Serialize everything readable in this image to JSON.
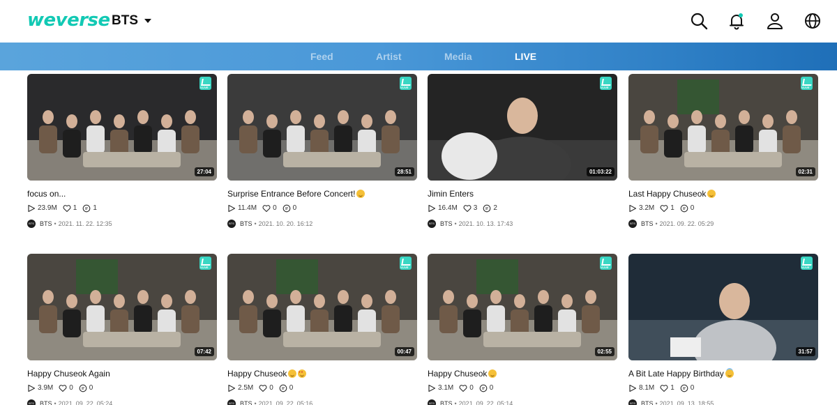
{
  "header": {
    "logo": "weverse",
    "artist": "BTS"
  },
  "nav": {
    "tabs": [
      {
        "label": "Feed",
        "active": false
      },
      {
        "label": "Artist",
        "active": false
      },
      {
        "label": "Media",
        "active": false
      },
      {
        "label": "LIVE",
        "active": true
      }
    ]
  },
  "colors": {
    "brand": "#12c9b4",
    "nav_start": "#5aa4dc",
    "nav_end": "#1f6fb8",
    "vlive_badge": "#39d6c3"
  },
  "videos": [
    {
      "title": "focus on...",
      "emoji": "",
      "duration": "27:04",
      "views": "23.9M",
      "likes": "1",
      "comments": "1",
      "author": "BTS",
      "date": "2021. 11. 22. 12:35"
    },
    {
      "title": "Surprise Entrance Before Concert!",
      "emoji": "smile",
      "duration": "28:51",
      "views": "11.4M",
      "likes": "0",
      "comments": "0",
      "author": "BTS",
      "date": "2021. 10. 20. 16:12"
    },
    {
      "title": "Jimin Enters",
      "emoji": "",
      "duration": "01:03:22",
      "views": "16.4M",
      "likes": "3",
      "comments": "2",
      "author": "BTS",
      "date": "2021. 10. 13. 17:43"
    },
    {
      "title": "Last Happy Chuseok",
      "emoji": "smile",
      "duration": "02:31",
      "views": "3.2M",
      "likes": "1",
      "comments": "0",
      "author": "BTS",
      "date": "2021. 09. 22. 05:29"
    },
    {
      "title": "Happy Chuseok Again",
      "emoji": "",
      "duration": "07:42",
      "views": "3.9M",
      "likes": "0",
      "comments": "0",
      "author": "BTS",
      "date": "2021. 09. 22. 05:24"
    },
    {
      "title": "Happy Chuseok",
      "emoji": "smile heart-eyes",
      "duration": "00:47",
      "views": "2.5M",
      "likes": "0",
      "comments": "0",
      "author": "BTS",
      "date": "2021. 09. 22. 05:16"
    },
    {
      "title": "Happy Chuseok",
      "emoji": "smile",
      "duration": "02:55",
      "views": "3.1M",
      "likes": "0",
      "comments": "0",
      "author": "BTS",
      "date": "2021. 09. 22. 05:14"
    },
    {
      "title": "A Bit Late Happy Birthday",
      "emoji": "halo",
      "duration": "31:57",
      "views": "8.1M",
      "likes": "1",
      "comments": "0",
      "author": "BTS",
      "date": "2021. 09. 13. 18:55"
    }
  ]
}
